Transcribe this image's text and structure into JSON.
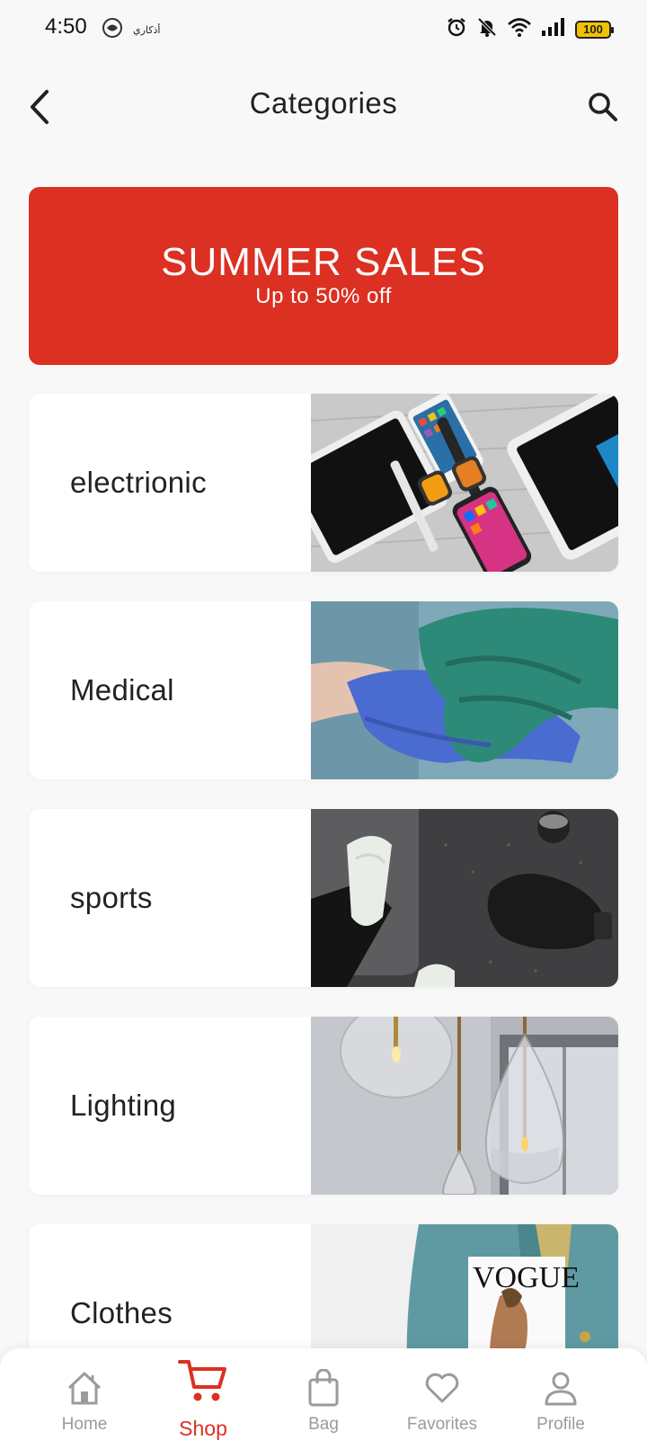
{
  "status_bar": {
    "time": "4:50",
    "left_label": "أذكاري",
    "battery": "100"
  },
  "header": {
    "title": "Categories"
  },
  "banner": {
    "title": "SUMMER SALES",
    "subtitle": "Up to 50% off"
  },
  "categories": [
    {
      "label": "electrionic"
    },
    {
      "label": "Medical"
    },
    {
      "label": "sports"
    },
    {
      "label": "Lighting"
    },
    {
      "label": "Clothes"
    }
  ],
  "bottom_nav": {
    "items": [
      {
        "label": "Home",
        "icon": "home-icon"
      },
      {
        "label": "Shop",
        "icon": "cart-icon",
        "active": true
      },
      {
        "label": "Bag",
        "icon": "bag-icon"
      },
      {
        "label": "Favorites",
        "icon": "heart-icon"
      },
      {
        "label": "Profile",
        "icon": "person-icon"
      }
    ]
  },
  "colors": {
    "accent": "#db3022",
    "background": "#f8f8f8",
    "inactive": "#9b9b9b"
  }
}
